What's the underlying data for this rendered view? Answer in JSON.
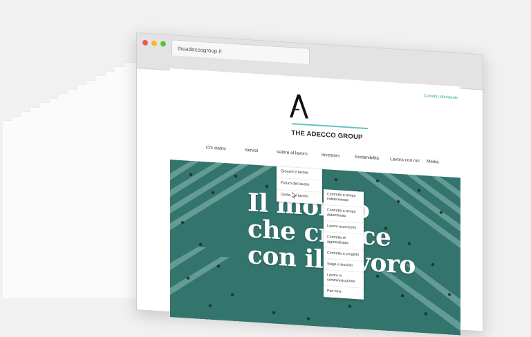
{
  "browser": {
    "tab_url": "theadeccogroup.it"
  },
  "site": {
    "top_links": "Contatti | Worldwide",
    "logo_text": "THE ADECCO GROUP",
    "logo_letter": "A",
    "accent_color": "#62c4bd",
    "nav": [
      {
        "label": "Chi siamo"
      },
      {
        "label": "Servizi"
      },
      {
        "label": "Valore al lavoro"
      },
      {
        "label": "Investors"
      },
      {
        "label": "Sostenibilità"
      },
      {
        "label": "Lavora con noi"
      },
      {
        "label": "Media"
      }
    ],
    "hero_lines": [
      "Il mondo",
      "che cresce",
      "con il lavoro"
    ],
    "dropdown": [
      {
        "label": "Giovani e lavoro"
      },
      {
        "label": "Futuro del lavoro"
      },
      {
        "label": "Diritto del lavoro"
      }
    ],
    "submenu": [
      {
        "label": "Contratto a tempo indeterminato"
      },
      {
        "label": "Contratto a tempo determinato"
      },
      {
        "label": "Lavoro accessorio"
      },
      {
        "label": "Contratto di apprendistato"
      },
      {
        "label": "Contratto a progetto"
      },
      {
        "label": "Stage e tirocinio"
      },
      {
        "label": "Lavoro in somministrazione"
      },
      {
        "label": "Part time"
      }
    ]
  }
}
